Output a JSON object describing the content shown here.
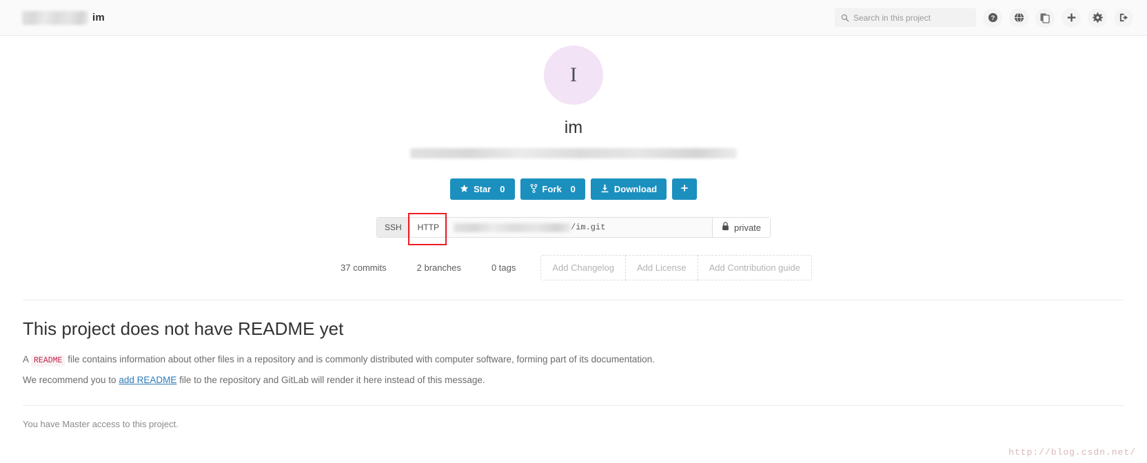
{
  "navbar": {
    "brand_redacted": true,
    "brand_name": "im",
    "search": {
      "placeholder": "Search in this project",
      "value": "",
      "icon": "search-icon"
    },
    "icons": [
      {
        "name": "help-icon",
        "title": "Help"
      },
      {
        "name": "globe-icon",
        "title": "Public"
      },
      {
        "name": "copy-files-icon",
        "title": "Snippets"
      },
      {
        "name": "plus-icon",
        "title": "New"
      },
      {
        "name": "gear-icon",
        "title": "Settings"
      },
      {
        "name": "sign-out-icon",
        "title": "Sign out"
      }
    ]
  },
  "project": {
    "avatar_initial": "I",
    "avatar_color": "#f3e3f6",
    "title": "im",
    "description_redacted": true,
    "actions": [
      {
        "name": "star-button",
        "icon": "star-icon",
        "label": "Star",
        "count": "0"
      },
      {
        "name": "fork-button",
        "icon": "fork-icon",
        "label": "Fork",
        "count": "0"
      },
      {
        "name": "download-button",
        "icon": "download-icon",
        "label": "Download",
        "count": ""
      },
      {
        "name": "more-button",
        "icon": "plus-icon",
        "label": "+",
        "count": ""
      }
    ],
    "accent_color": "#1b90bf"
  },
  "clone": {
    "tabs": [
      {
        "label": "SSH",
        "active": false,
        "highlighted": false
      },
      {
        "label": "HTTP",
        "active": true,
        "highlighted": true
      }
    ],
    "highlight_color": "#ee1c25",
    "url_host_redacted": true,
    "url_path": "/im.git",
    "visibility_label": "private",
    "visibility_icon": "lock-icon"
  },
  "stats": [
    {
      "name": "commits-stat",
      "label": "37 commits"
    },
    {
      "name": "branches-stat",
      "label": "2 branches"
    },
    {
      "name": "tags-stat",
      "label": "0 tags"
    }
  ],
  "add_buttons": [
    {
      "name": "add-changelog-button",
      "label": "Add Changelog"
    },
    {
      "name": "add-license-button",
      "label": "Add License"
    },
    {
      "name": "add-contribution-guide-button",
      "label": "Add Contribution guide"
    }
  ],
  "readme": {
    "heading": "This project does not have README yet",
    "line1_prefix": "A",
    "line1_code": "README",
    "line1_suffix": "file contains information about other files in a repository and is commonly distributed with computer software, forming part of its documentation.",
    "line2_prefix": "We recommend you to",
    "line2_link": "add README",
    "line2_suffix": "file to the repository and GitLab will render it here instead of this message."
  },
  "footer": {
    "access_note": "You have Master access to this project.",
    "watermark": "http://blog.csdn.net/"
  }
}
